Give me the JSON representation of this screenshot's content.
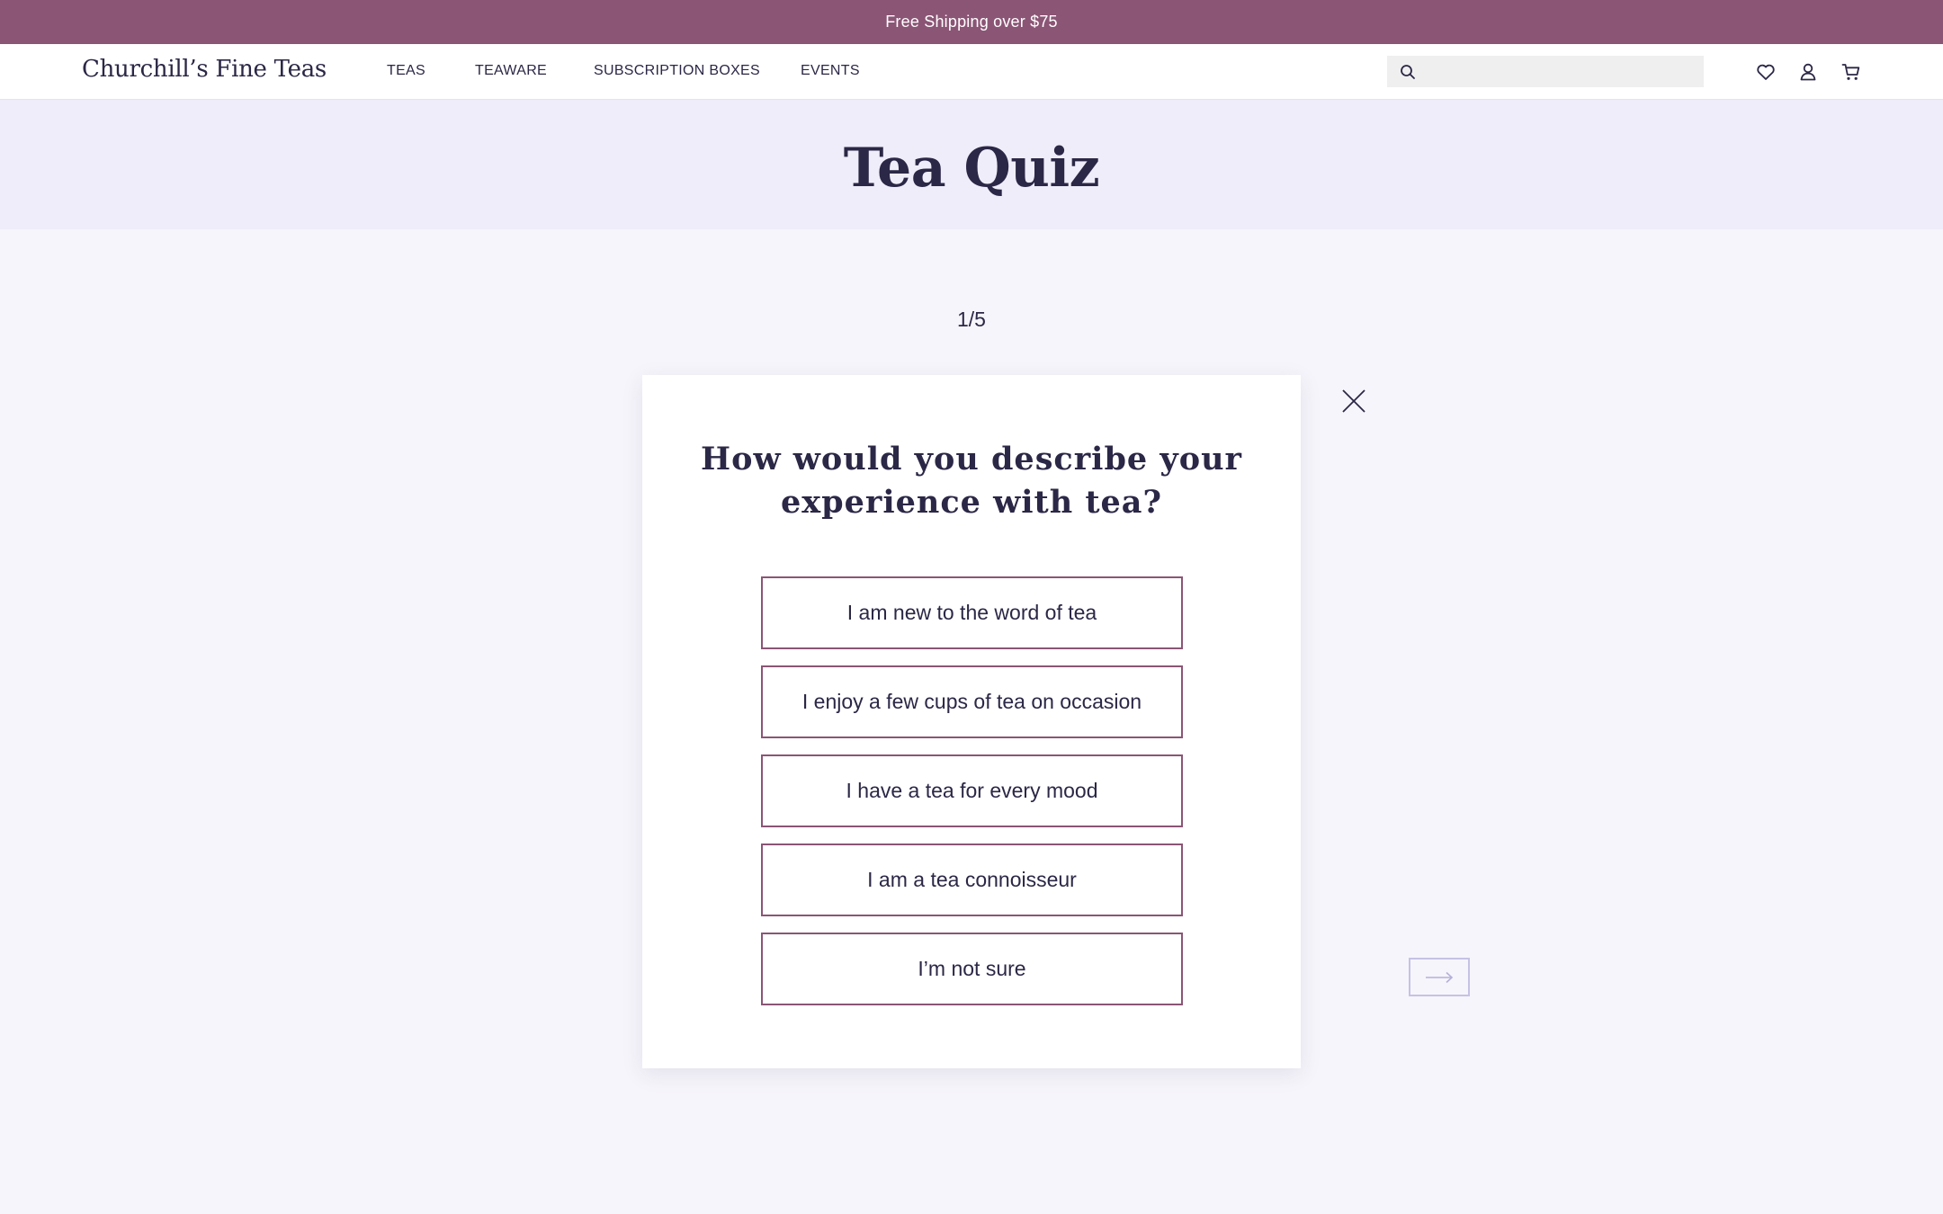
{
  "promo": {
    "text": "Free Shipping over $75"
  },
  "header": {
    "logo": "Churchill’s Fine Teas",
    "nav": [
      {
        "label": "TEAS"
      },
      {
        "label": "TEAWARE"
      },
      {
        "label": "SUBSCRIPTION BOXES"
      },
      {
        "label": "EVENTS"
      }
    ],
    "search": {
      "value": "",
      "placeholder": ""
    },
    "icons": [
      "search-icon",
      "heart-icon",
      "user-icon",
      "cart-icon"
    ]
  },
  "hero": {
    "title": "Tea Quiz"
  },
  "quiz": {
    "step": "1/5",
    "question": "How would you describe your experience with tea?",
    "answers": [
      {
        "label": "I am new to the word of tea"
      },
      {
        "label": "I enjoy a few cups of tea on occasion"
      },
      {
        "label": "I have a tea for every mood"
      },
      {
        "label": "I am a tea connoisseur"
      },
      {
        "label": "I’m not sure"
      }
    ],
    "close_icon": "close-icon",
    "next_icon": "arrow-right-icon"
  },
  "colors": {
    "brand": "#8b5575",
    "text": "#2b2746",
    "hero_bg": "#efedf9",
    "page_bg": "#f6f5fb",
    "next_border": "#c6c2e4"
  }
}
